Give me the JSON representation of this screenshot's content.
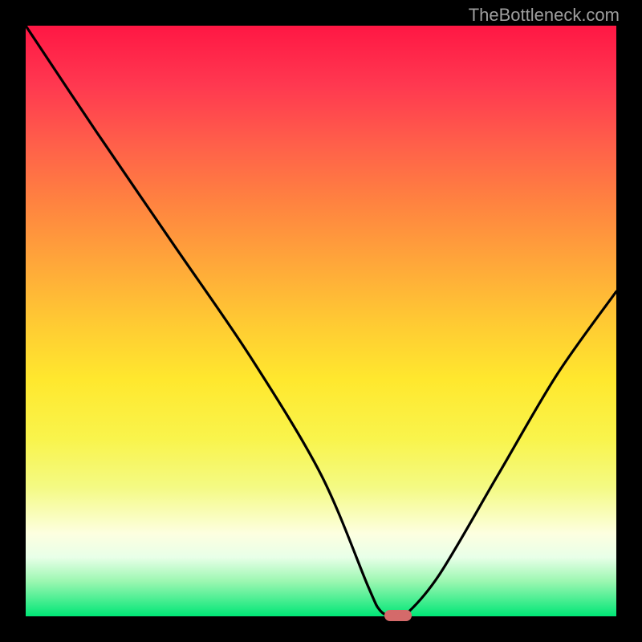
{
  "watermark": "TheBottleneck.com",
  "chart_data": {
    "type": "line",
    "title": "",
    "xlabel": "",
    "ylabel": "",
    "xlim": [
      0,
      100
    ],
    "ylim": [
      0,
      100
    ],
    "grid": false,
    "background_gradient_stops": [
      {
        "pos": 0,
        "color": "#ff1744"
      },
      {
        "pos": 50,
        "color": "#ffe82e"
      },
      {
        "pos": 100,
        "color": "#00e676"
      }
    ],
    "series": [
      {
        "name": "bottleneck-curve",
        "x": [
          0,
          12,
          25,
          38,
          50,
          58,
          60,
          62,
          64,
          70,
          80,
          90,
          100
        ],
        "values": [
          100,
          82,
          63,
          44,
          24,
          5,
          1,
          0,
          0,
          7,
          24,
          41,
          55
        ]
      }
    ],
    "marker": {
      "name": "optimal-point",
      "x": 63,
      "value": 0,
      "color": "#d46a6a"
    }
  }
}
